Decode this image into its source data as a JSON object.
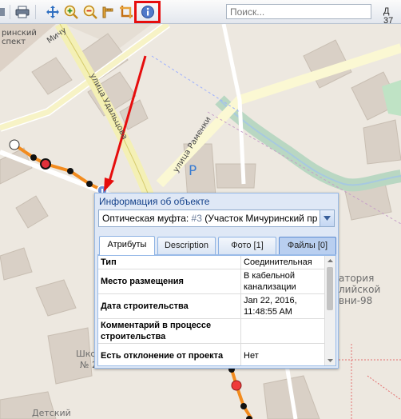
{
  "toolbar": {
    "search_placeholder": "Поиск...",
    "coord_text": "Д 37"
  },
  "map_labels": {
    "street_1": "улица Удальцова",
    "street_2": "улица Раменки",
    "street_3": "Мичу",
    "prospect": "ринский\nспект",
    "parking": "P",
    "lab_line1": "атория",
    "lab_line2": "лийской",
    "lab_line3": "вни-98",
    "school_1": "Школ",
    "school_2": "№ 2",
    "kindergarten": "Детский"
  },
  "popup": {
    "title": "Информация об объекте",
    "combo_prefix": "Оптическая муфта: ",
    "combo_id": "#3",
    "combo_rest": " (Участок Мичуринский пр",
    "tabs": [
      "Атрибуты",
      "Description",
      "Фото [1]",
      "Файлы [0]"
    ],
    "rows": [
      {
        "key": "Тип",
        "value": "Соединительная"
      },
      {
        "key": "Место размещения",
        "value": "В кабельной канализации"
      },
      {
        "key": "Дата строительства",
        "value": "Jan 22, 2016, 11:48:55 AM"
      },
      {
        "key": "Комментарий в процессе строительства",
        "value": ""
      },
      {
        "key": "Есть отклонение от проекта",
        "value": "Нет"
      }
    ]
  },
  "colors": {
    "highlight": "#e60d0d",
    "route": "#f28b1e",
    "popup_header": "#15428b"
  },
  "icons": [
    "printer-icon",
    "pan-icon",
    "zoom-in-icon",
    "zoom-out-icon",
    "measure-icon",
    "crop-icon",
    "info-icon"
  ]
}
